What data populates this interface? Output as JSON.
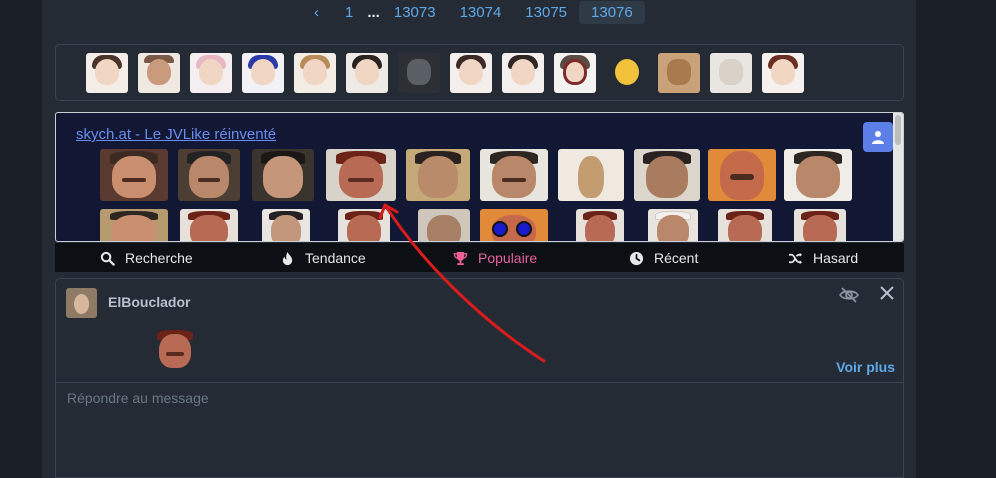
{
  "pagination": {
    "prev": "‹",
    "pages": [
      "1",
      "...",
      "13073",
      "13074",
      "13075",
      "13076"
    ],
    "active": "13076"
  },
  "sticker_strip": {
    "items": [
      "anime-girl-wave",
      "man-thinking",
      "pink-hair-girl",
      "blue-hair-girl",
      "smiling-girl",
      "dark-hair-girl",
      "wolf",
      "girl-pointing",
      "girl-shy",
      "magnifier-girl",
      "thinking-emoji",
      "cat",
      "dog",
      "brown-hair-girl"
    ]
  },
  "embed": {
    "link_text": "skych.at - Le JVLike réinventé",
    "user_icon": "user-icon"
  },
  "tabs": [
    {
      "label": "Recherche",
      "icon": "search-icon"
    },
    {
      "label": "Tendance",
      "icon": "flame-icon"
    },
    {
      "label": "Populaire",
      "icon": "trophy-icon"
    },
    {
      "label": "Récent",
      "icon": "clock-icon"
    },
    {
      "label": "Hasard",
      "icon": "shuffle-icon"
    }
  ],
  "active_tab": "Populaire",
  "message": {
    "username": "ElBouclador",
    "show_more": "Voir plus"
  },
  "reply": {
    "placeholder": "Répondre au message"
  },
  "colors": {
    "accent": "#5ea8e8",
    "active_tab": "#e9609a",
    "embed_bg": "#121833",
    "annotation": "#d81c1c"
  }
}
